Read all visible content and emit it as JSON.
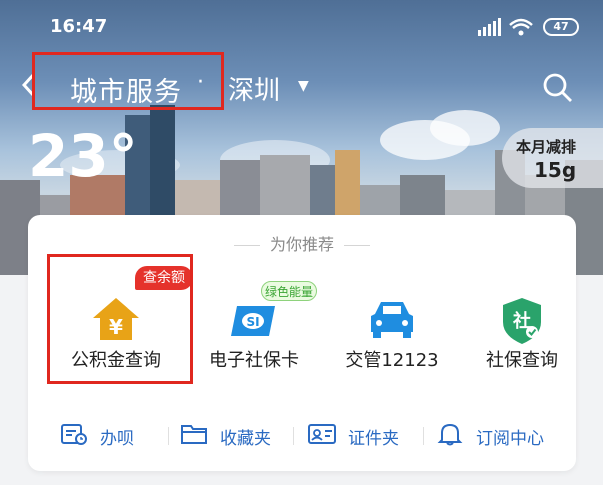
{
  "status_bar": {
    "time": "16:47",
    "battery": "47"
  },
  "header": {
    "back_icon": "chevron-left-icon",
    "title": "城市服务",
    "separator": "·",
    "city": "深圳",
    "city_caret": "▼",
    "search_icon": "search-icon"
  },
  "weather": {
    "temperature": "23°"
  },
  "carbon": {
    "label": "本月减排",
    "value": "15g"
  },
  "recommend": {
    "title": "为你推荐",
    "items": [
      {
        "label": "公积金查询",
        "icon": "house-yuan-icon",
        "badge": "查余额",
        "color": "#e8a317"
      },
      {
        "label": "电子社保卡",
        "icon": "social-security-card-icon",
        "badge": "绿色能量",
        "color": "#1f8de0"
      },
      {
        "label": "交管12123",
        "icon": "car-icon",
        "color": "#1f8de0"
      },
      {
        "label": "社保查询",
        "icon": "shield-she-icon",
        "color": "#2aa36b"
      }
    ]
  },
  "quick_links": [
    {
      "label": "办呗",
      "icon": "calendar-clock-icon"
    },
    {
      "label": "收藏夹",
      "icon": "folder-icon"
    },
    {
      "label": "证件夹",
      "icon": "id-card-icon"
    },
    {
      "label": "订阅中心",
      "icon": "bell-icon"
    }
  ],
  "colors": {
    "accent": "#2a6ac2",
    "highlight_box": "#e0281f",
    "badge_red": "#e5322b",
    "badge_green": "#3aa534"
  }
}
